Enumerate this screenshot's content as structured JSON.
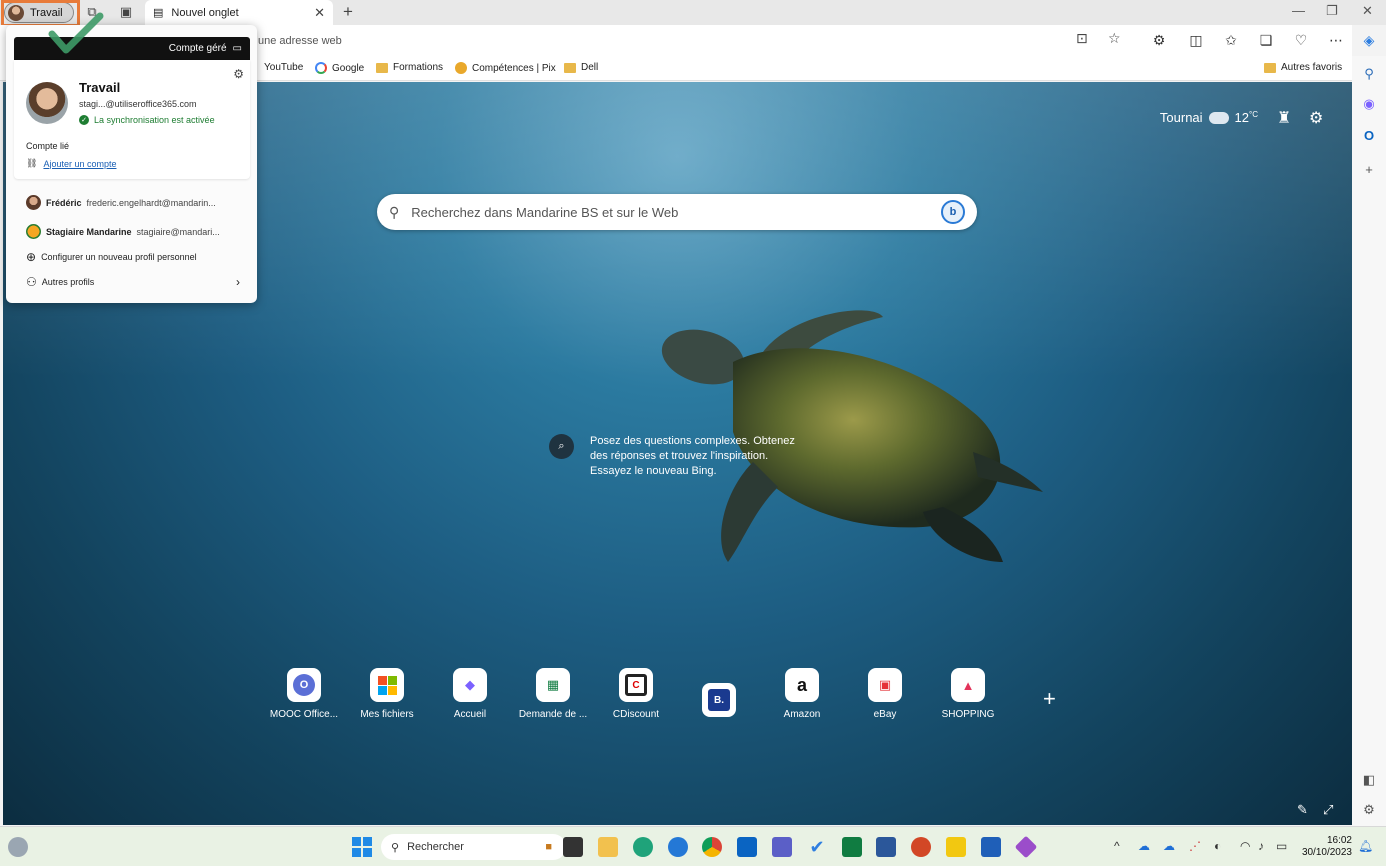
{
  "browser": {
    "profile_label": "Travail",
    "tab_title": "Nouvel onglet",
    "address_placeholder": "une adresse web",
    "favorites": [
      {
        "label": "YouTube"
      },
      {
        "label": "Google"
      },
      {
        "label": "Formations"
      },
      {
        "label": "Compétences | Pix"
      },
      {
        "label": "Dell"
      }
    ],
    "other_favorites": "Autres favoris"
  },
  "flyout": {
    "managed_label": "Compte géré",
    "profile_name": "Travail",
    "email": "stagi...@utiliseroffice365.com",
    "sync_status": "La synchronisation est activée",
    "linked_label": "Compte lié",
    "add_account": "Ajouter un compte",
    "other_profiles_list": [
      {
        "name": "Frédéric",
        "email": "frederic.engelhardt@mandarin..."
      },
      {
        "name": "Stagiaire Mandarine",
        "email": "stagiaire@mandari..."
      }
    ],
    "new_profile": "Configurer un nouveau profil personnel",
    "other_profiles": "Autres profils"
  },
  "ntp": {
    "city": "Tournai",
    "temperature": "12",
    "temp_unit": "°C",
    "search_placeholder": "Recherchez dans Mandarine BS et sur le Web",
    "bing_prompt_lines": [
      "Posez des questions complexes. Obtenez",
      "des réponses et trouvez l'inspiration.",
      "Essayez le nouveau Bing."
    ],
    "quick_links": [
      {
        "label": "MOOC Office...",
        "glyph": "O",
        "color": "#5b6fd6"
      },
      {
        "label": "Mes fichiers",
        "glyph": "",
        "color": "#f25022"
      },
      {
        "label": "Accueil",
        "glyph": "◆",
        "color": "#7b61ff"
      },
      {
        "label": "Demande de ...",
        "glyph": "▦",
        "color": "#107c41"
      },
      {
        "label": "CDiscount",
        "glyph": "C",
        "color": "#222222"
      },
      {
        "label": "",
        "glyph": "B.",
        "color": "#1a3a8f"
      },
      {
        "label": "Amazon",
        "glyph": "a",
        "color": "#111111"
      },
      {
        "label": "eBay",
        "glyph": "▣",
        "color": "#e53238"
      },
      {
        "label": "SHOPPING",
        "glyph": "▲",
        "color": "#e3335a"
      }
    ]
  },
  "taskbar": {
    "search_placeholder": "Rechercher",
    "time": "16:02",
    "date": "30/10/2023"
  }
}
